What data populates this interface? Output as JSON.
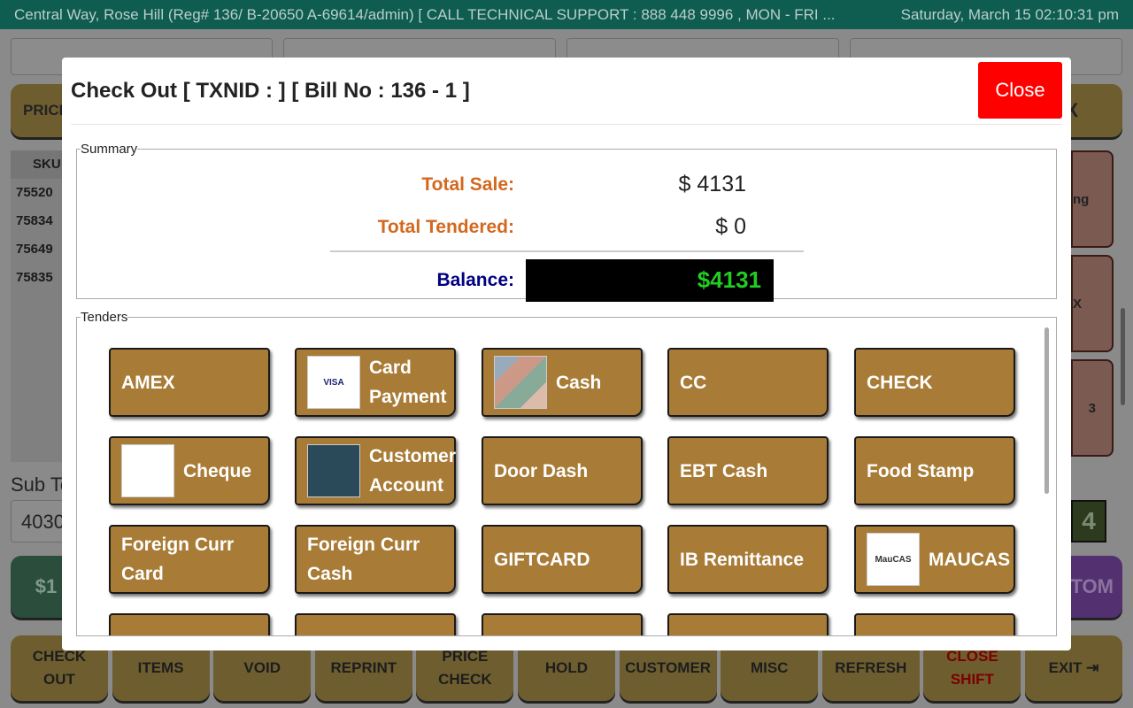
{
  "topbar": {
    "title": "Central Way, Rose Hill (Reg# 136/ B-20650 A-69614/admin) [ CALL TECHNICAL SUPPORT : 888 448 9996 , MON - FRI ...",
    "datetime": "Saturday, March 15 02:10:31 pm"
  },
  "background": {
    "price_btn": "PRICE",
    "tax_btn": "X",
    "sku_header": "SKU",
    "skus": [
      "75520",
      "75834",
      "75649",
      "75835"
    ],
    "right_items": [
      "ng",
      "X",
      "3"
    ],
    "subtotal_label": "Sub Total",
    "subtotal_value": "4030",
    "total_btn": "$1",
    "counter": "4",
    "custom_btn": "TOM"
  },
  "modal": {
    "title": "Check Out [ TXNID : ] [ Bill No : 136 - 1 ]",
    "close": "Close",
    "summary": {
      "legend": "Summary",
      "total_sale_label": "Total Sale:",
      "total_sale": "$ 4131",
      "total_tendered_label": "Total Tendered:",
      "total_tendered": "$ 0",
      "balance_label": "Balance:",
      "balance": "$4131"
    },
    "tenders_legend": "Tenders",
    "tenders": [
      {
        "label": "AMEX"
      },
      {
        "label": "Card Payment",
        "icon": "visa-mastercard-icon",
        "icon_text": "VISA"
      },
      {
        "label": "Cash",
        "icon": "banknotes-icon"
      },
      {
        "label": "CC"
      },
      {
        "label": "CHECK"
      },
      {
        "label": "Cheque",
        "icon": "cheque-icon"
      },
      {
        "label": "Customer Account",
        "icon": "customer-account-icon"
      },
      {
        "label": "Door Dash"
      },
      {
        "label": "EBT Cash"
      },
      {
        "label": "Food Stamp"
      },
      {
        "label": "Foreign Curr Card"
      },
      {
        "label": "Foreign Curr Cash"
      },
      {
        "label": "GIFTCARD"
      },
      {
        "label": "IB Remittance"
      },
      {
        "label": "MAUCAS",
        "icon": "maucas-logo-icon",
        "icon_text": "MauCAS"
      }
    ]
  },
  "bottom_nav": [
    "CHECK OUT",
    "ITEMS",
    "VOID",
    "REPRINT",
    "PRICE CHECK",
    "HOLD",
    "CUSTOMER",
    "MISC",
    "REFRESH",
    "CLOSE SHIFT",
    "EXIT ⇥"
  ],
  "colors": {
    "tender": "#a87b36",
    "close": "#ff0000",
    "balance_text": "#22cc22",
    "label_orange": "#d2691e",
    "label_navy": "#000080",
    "close_shift_text": "#b00000"
  }
}
